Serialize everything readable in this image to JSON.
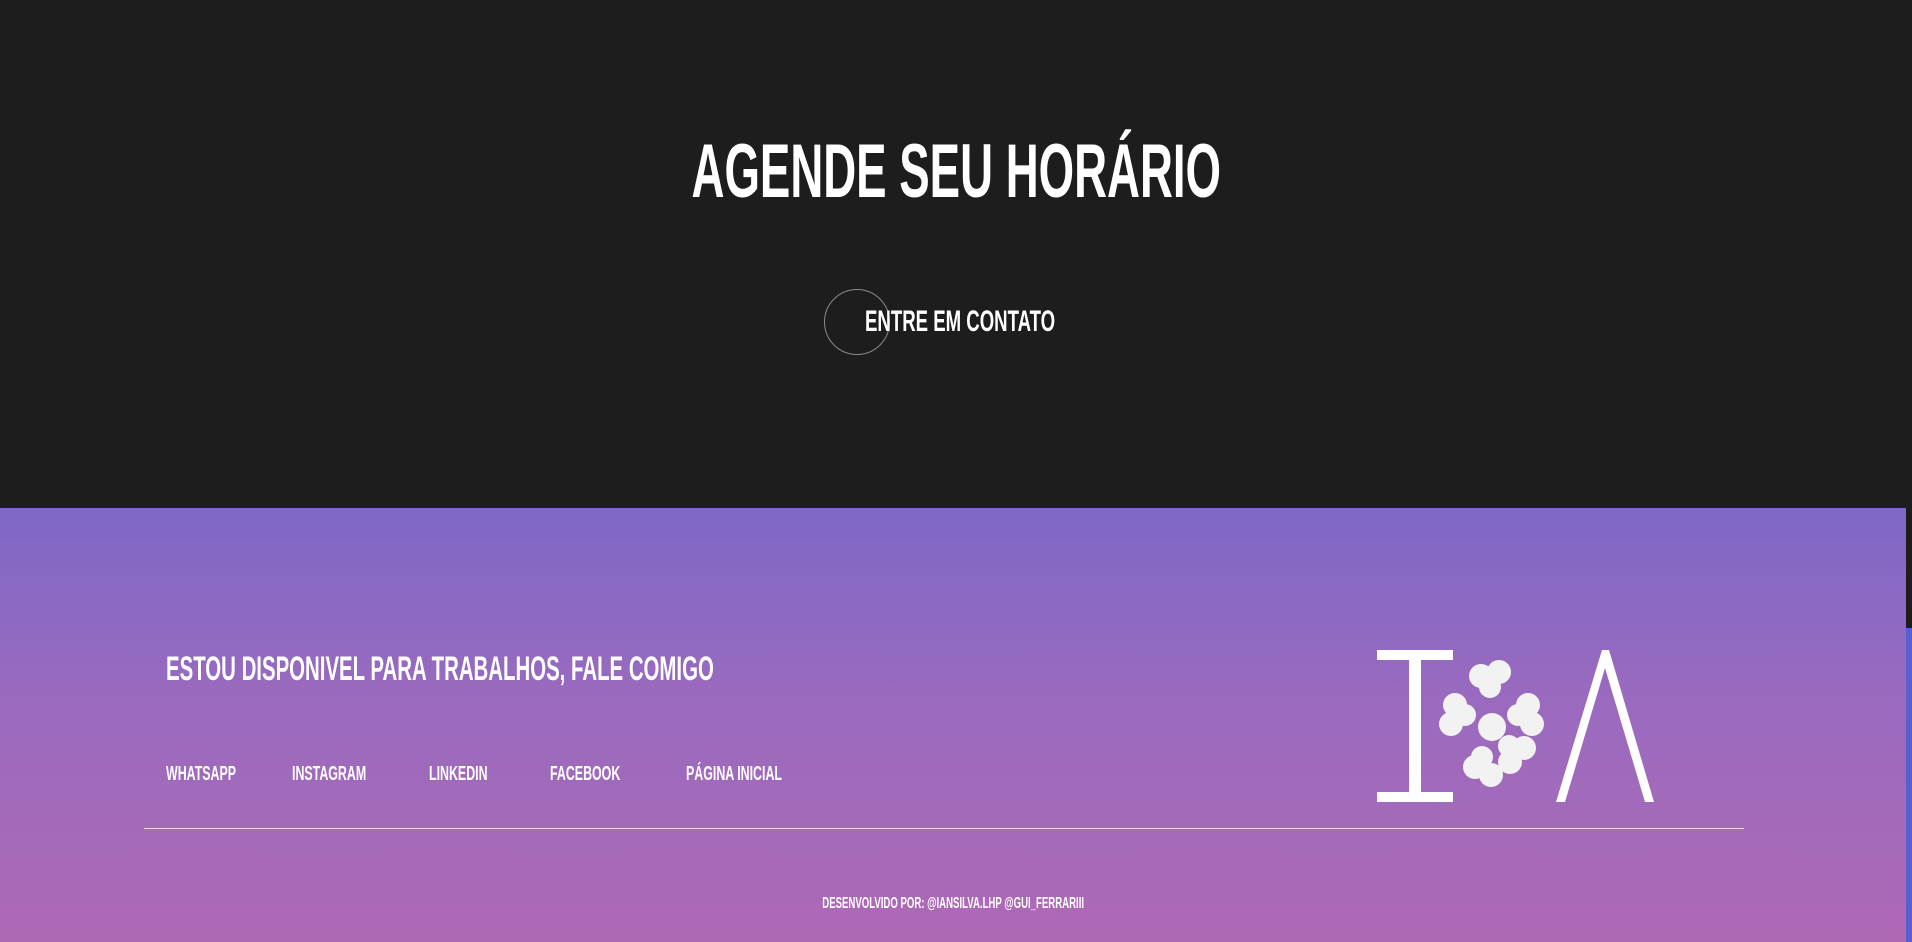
{
  "hero": {
    "title": "AGENDE SEU HORÁRIO",
    "cta_label": "ENTRE EM CONTATO"
  },
  "footer": {
    "tagline": "ESTOU DISPONIVEL PARA TRABALHOS, FALE COMIGO",
    "links": [
      {
        "label": "WHATSAPP"
      },
      {
        "label": "INSTAGRAM"
      },
      {
        "label": "LINKEDIN"
      },
      {
        "label": "FACEBOOK"
      },
      {
        "label": "PÁGINA INICIAL"
      }
    ],
    "credits": "DESENVOLVIDO POR: @IANSILVA.LHP @GUI_FERRARIII",
    "logo": {
      "text_left": "I",
      "text_right": "A",
      "icon": "clover-flower-icon"
    }
  },
  "colors": {
    "hero_background": "#1d1d1d",
    "footer_gradient_top": "#7e68c6",
    "footer_gradient_bottom": "#ae69b4",
    "text": "#ffffff"
  }
}
